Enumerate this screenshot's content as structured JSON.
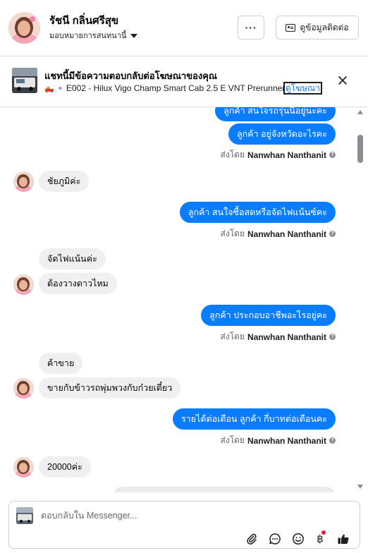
{
  "header": {
    "contact_name": "รัชนี กลิ่นศรีสุข",
    "assign_label": "มอบหมายการสนทนานี้",
    "more_label": "···",
    "contact_info_label": "ดูข้อมูลติดต่อ"
  },
  "ad_banner": {
    "title": "แชทนี้มีข้อความตอบกลับต่อโฆษณาของคุณ",
    "subtitle": "E002 - Hilux Vigo Champ Smart Cab 2.5 E VNT Prerunner (A...",
    "link_label": "ดูโฆษณา"
  },
  "thread": {
    "messages": [
      {
        "direction": "out",
        "text": "ลูกค้า สนใจรถรุ่นนี้อยู่นะคะ"
      },
      {
        "direction": "out",
        "text": "ลูกค้า อยู่จังหวัดอะไรคะ"
      },
      {
        "direction": "meta",
        "prefix": "ส่งโดย",
        "name": "Nanwhan Nanthanit"
      },
      {
        "direction": "in",
        "text": "ชัยภูมิค่ะ"
      },
      {
        "direction": "out",
        "text": "ลูกค้า สนใจซื้อสดหรือจัดไฟแน้นซ์คะ"
      },
      {
        "direction": "meta",
        "prefix": "ส่งโดย",
        "name": "Nanwhan Nanthanit"
      },
      {
        "direction": "in",
        "text": "จัดไฟแน้นค่ะ"
      },
      {
        "direction": "in",
        "text": "ต้องวางดาวไหม"
      },
      {
        "direction": "out",
        "text": "ลูกค้า ประกอบอาชีพอะไรอยู่คะ"
      },
      {
        "direction": "meta",
        "prefix": "ส่งโดย",
        "name": "Nanwhan Nanthanit"
      },
      {
        "direction": "in",
        "text": "ค้าขาย"
      },
      {
        "direction": "in",
        "text": "ขายกับข้าวรถพุ่มพวงกับก๋วยเตี๋ยว"
      },
      {
        "direction": "out",
        "text": "รายได้ต่อเดือน ลูกค้า กี่บาทต่อเดือนคะ"
      },
      {
        "direction": "meta",
        "prefix": "ส่งโดย",
        "name": "Nanwhan Nanthanit"
      },
      {
        "direction": "in",
        "text": "20000ค่ะ"
      }
    ]
  },
  "composer": {
    "placeholder": "ตอบกลับใน Messenger...",
    "currency_symbol": "฿"
  },
  "colors": {
    "outgoing_bubble": "#0a7cff",
    "incoming_bubble": "#f0f0f0",
    "accent": "#1877f2",
    "notification_dot": "#e41e3f"
  },
  "icons": [
    "more-icon",
    "contact-card-icon",
    "close-icon",
    "attach-icon",
    "chat-icon",
    "emoji-icon",
    "baht-icon",
    "like-icon"
  ]
}
